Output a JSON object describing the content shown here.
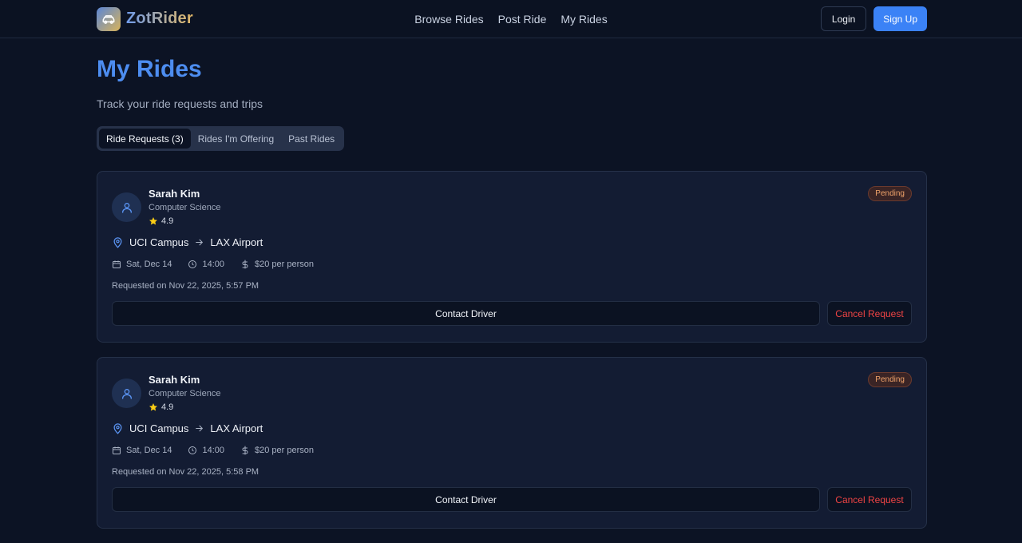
{
  "brand": {
    "name": "ZotRider",
    "logo_icon": "car-icon"
  },
  "nav": {
    "links": [
      "Browse Rides",
      "Post Ride",
      "My Rides"
    ],
    "login_label": "Login",
    "signup_label": "Sign Up"
  },
  "page": {
    "title": "My Rides",
    "subtitle": "Track your ride requests and trips"
  },
  "tabs": [
    {
      "label": "Ride Requests (3)",
      "active": true
    },
    {
      "label": "Rides I'm Offering",
      "active": false
    },
    {
      "label": "Past Rides",
      "active": false
    }
  ],
  "requests": [
    {
      "driver_name": "Sarah Kim",
      "driver_major": "Computer Science",
      "rating": "4.9",
      "status": "Pending",
      "from": "UCI Campus",
      "to": "LAX Airport",
      "date": "Sat, Dec 14",
      "time": "14:00",
      "price": "$20 per person",
      "requested_on": "Requested on Nov 22, 2025, 5:57 PM",
      "contact_label": "Contact Driver",
      "cancel_label": "Cancel Request"
    },
    {
      "driver_name": "Sarah Kim",
      "driver_major": "Computer Science",
      "rating": "4.9",
      "status": "Pending",
      "from": "UCI Campus",
      "to": "LAX Airport",
      "date": "Sat, Dec 14",
      "time": "14:00",
      "price": "$20 per person",
      "requested_on": "Requested on Nov 22, 2025, 5:58 PM",
      "contact_label": "Contact Driver",
      "cancel_label": "Cancel Request"
    }
  ],
  "colors": {
    "accent": "#3b82f6",
    "title": "#4d8df0",
    "danger": "#ef4444",
    "pending": "#f0a36a",
    "star": "#facc15"
  }
}
